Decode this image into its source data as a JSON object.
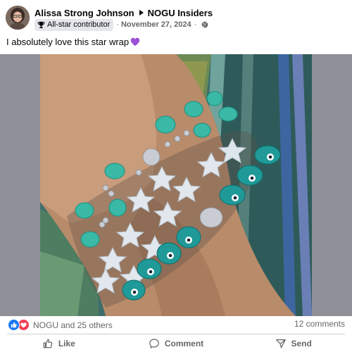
{
  "post": {
    "author": "Alissa Strong Johnson",
    "group": "NOGU Insiders",
    "badge_label": "All-star contributor",
    "date": "November 27, 2024",
    "separator": "·",
    "text": "I absolutely love this star wrap"
  },
  "icons": {
    "avatar": "profile-avatar",
    "arrow": "right-triangle-icon",
    "badge": "trophy-icon",
    "privacy": "globe-icon",
    "emoji": "purple-heart-icon",
    "reactions": [
      "like-icon",
      "love-icon"
    ],
    "actions": [
      "thumbs-up-icon",
      "comment-bubble-icon",
      "send-icon"
    ]
  },
  "colors": {
    "like": "#1877f2",
    "love": "#f33e58",
    "heart_emoji": "#9b4fd6",
    "secondary_text": "#65676b"
  },
  "engagement": {
    "reactions_text": "NOGU and 25 others",
    "comments_text": "12 comments"
  },
  "actions": {
    "like": "Like",
    "comment": "Comment",
    "send": "Send"
  }
}
